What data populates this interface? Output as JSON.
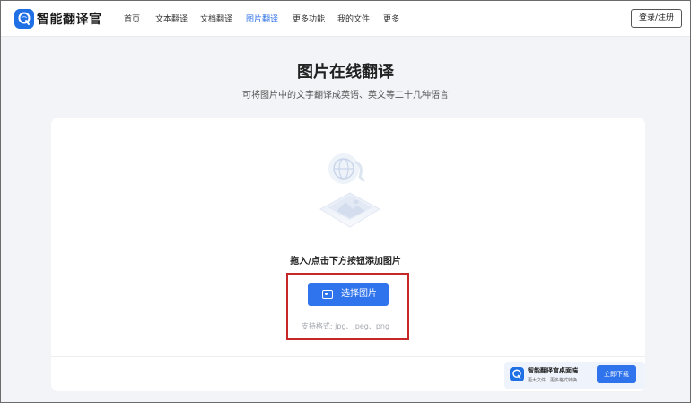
{
  "header": {
    "brand": "智能翻译官",
    "nav": [
      {
        "label": "首页",
        "active": false
      },
      {
        "label": "文本翻译",
        "active": false
      },
      {
        "label": "文档翻译",
        "active": false
      },
      {
        "label": "图片翻译",
        "active": true
      },
      {
        "label": "更多功能",
        "active": false
      },
      {
        "label": "我的文件",
        "active": false
      },
      {
        "label": "更多",
        "active": false
      }
    ],
    "login_label": "登录/注册"
  },
  "page": {
    "title": "图片在线翻译",
    "subtitle": "可将图片中的文字翻译成英语、英文等二十几种语言"
  },
  "upload": {
    "hint": "拖入/点击下方按钮添加图片",
    "button_label": "选择图片",
    "formats": "支持格式: jpg、jpeg、png"
  },
  "download_banner": {
    "title": "智能翻译官桌面端",
    "subtitle": "更大文件、更多格式转换",
    "button_label": "立即下载"
  },
  "colors": {
    "accent": "#2f74ec",
    "highlight": "#c62828"
  }
}
